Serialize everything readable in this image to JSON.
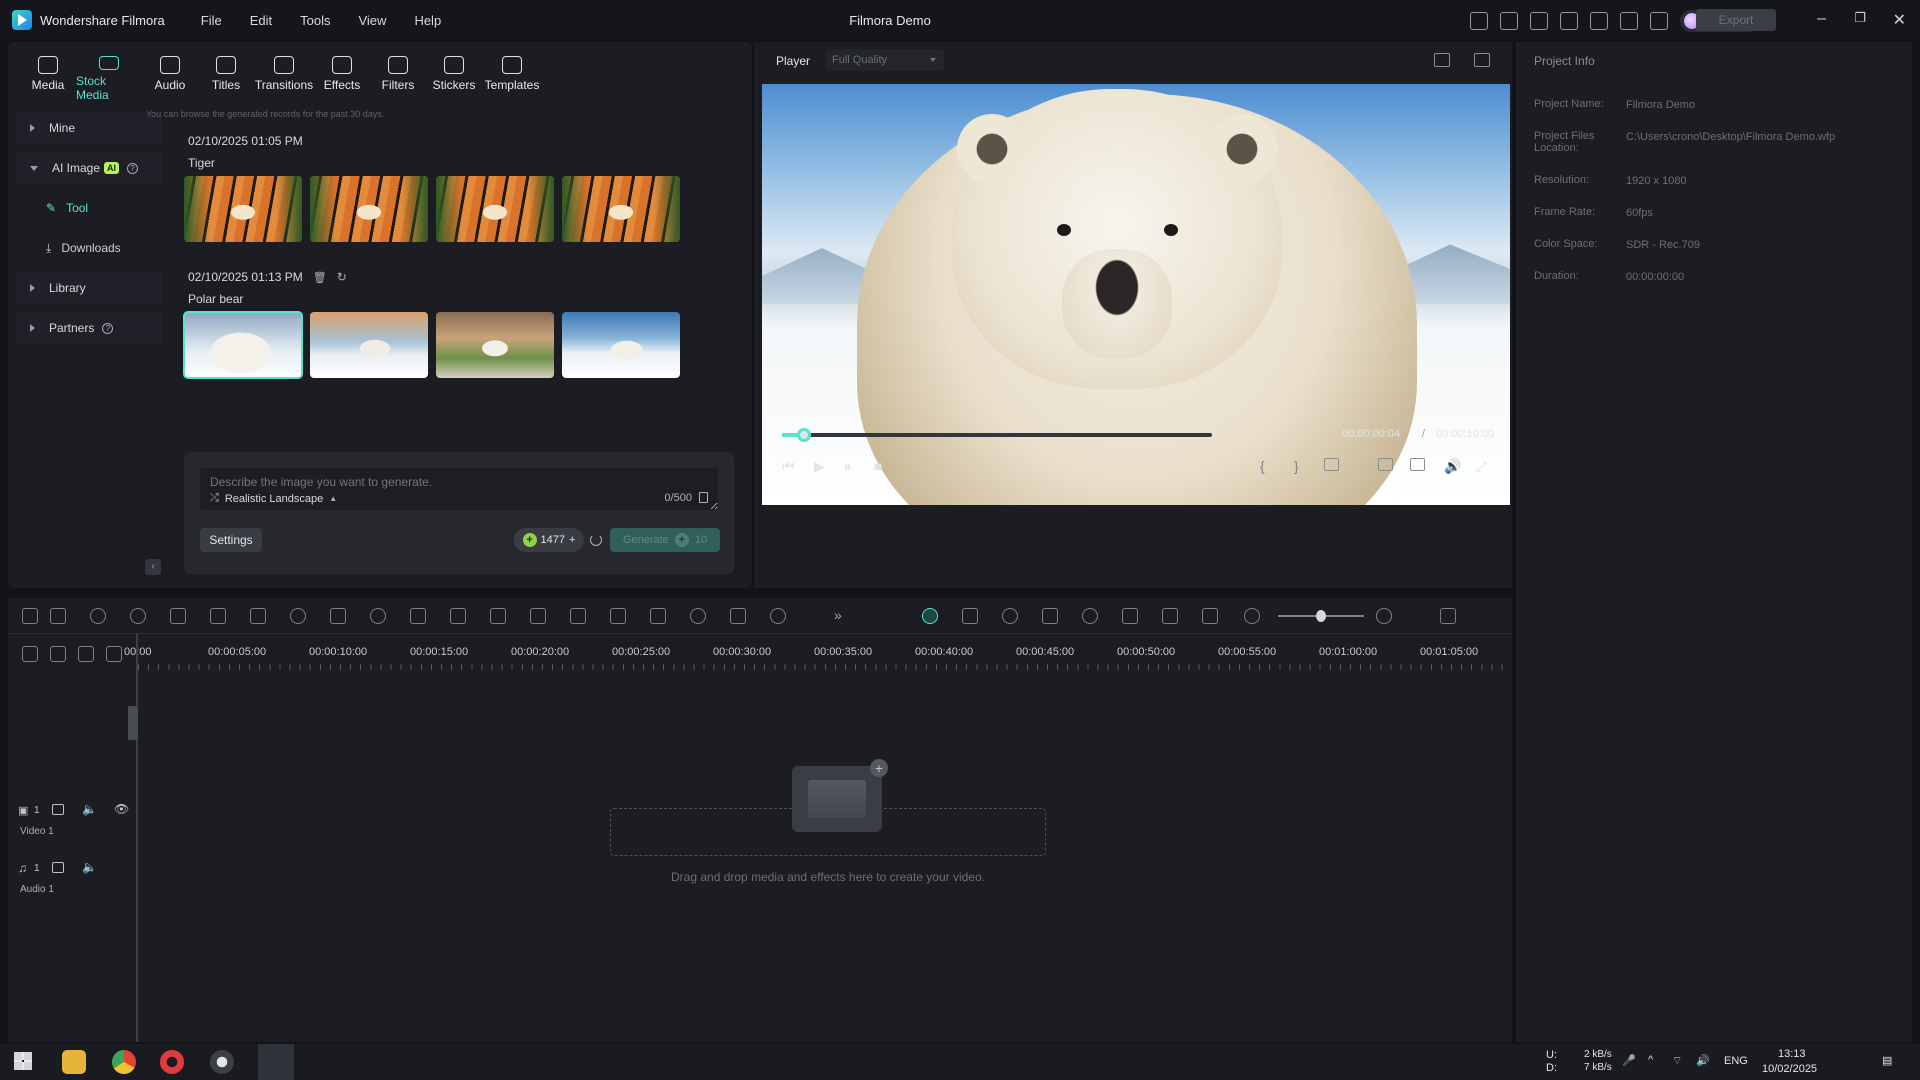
{
  "app": {
    "name": "Wondershare Filmora",
    "window_title": "Filmora Demo",
    "menu": [
      "File",
      "Edit",
      "Tools",
      "View",
      "Help"
    ],
    "credits": "1477",
    "export_label": "Export"
  },
  "tabs": [
    {
      "label": "Media",
      "icon": "media-icon",
      "active": false
    },
    {
      "label": "Stock Media",
      "icon": "stock-media-icon",
      "active": true
    },
    {
      "label": "Audio",
      "icon": "audio-icon",
      "active": false
    },
    {
      "label": "Titles",
      "icon": "titles-icon",
      "active": false
    },
    {
      "label": "Transitions",
      "icon": "transitions-icon",
      "active": false
    },
    {
      "label": "Effects",
      "icon": "effects-icon",
      "active": false
    },
    {
      "label": "Filters",
      "icon": "filters-icon",
      "active": false
    },
    {
      "label": "Stickers",
      "icon": "stickers-icon",
      "active": false
    },
    {
      "label": "Templates",
      "icon": "templates-icon",
      "active": false
    }
  ],
  "sidebar": {
    "mine": "Mine",
    "ai_image": "AI Image",
    "ai_badge": "AI",
    "tool": "Tool",
    "downloads": "Downloads",
    "library": "Library",
    "partners": "Partners"
  },
  "records_note": "You can browse the generated records for the past 30 days.",
  "groups": [
    {
      "date": "02/10/2025 01:05 PM",
      "label": "Tiger"
    },
    {
      "date": "02/10/2025 01:13 PM",
      "label": "Polar bear"
    }
  ],
  "generator": {
    "placeholder": "Describe the image you want to generate.",
    "style": "Realistic Landscape",
    "counter": "0/500",
    "settings_label": "Settings",
    "cost": "1477",
    "generate_label": "Generate",
    "generate_cost": "10"
  },
  "player": {
    "label": "Player",
    "quality": "Full Quality",
    "current_time": "00:00:00:04",
    "separator": "/",
    "total_time": "00:00:10:00",
    "progress": 0.05
  },
  "project_info": {
    "title": "Project Info",
    "rows": [
      {
        "k": "Project Name:",
        "v": "Filmora Demo"
      },
      {
        "k": "Project Files Location:",
        "v": "C:\\Users\\crono\\Desktop\\Filmora Demo.wfp"
      },
      {
        "k": "Resolution:",
        "v": "1920 x 1080"
      },
      {
        "k": "Frame Rate:",
        "v": "60fps"
      },
      {
        "k": "Color Space:",
        "v": "SDR - Rec.709"
      },
      {
        "k": "Duration:",
        "v": "00:00:00:00"
      }
    ]
  },
  "timeline": {
    "ticks": [
      "00:00",
      "00:00:05:00",
      "00:00:10:00",
      "00:00:15:00",
      "00:00:20:00",
      "00:00:25:00",
      "00:00:30:00",
      "00:00:35:00",
      "00:00:40:00",
      "00:00:45:00",
      "00:00:50:00",
      "00:00:55:00",
      "00:01:00:00",
      "00:01:05:00"
    ],
    "video_track": "Video 1",
    "audio_track": "Audio 1",
    "video_num": "1",
    "audio_num": "1",
    "drop_text": "Drag and drop media and effects here to create your video."
  },
  "taskbar": {
    "net_up_label": "U:",
    "net_down_label": "D:",
    "net_up": "2 kB/s",
    "net_down": "7 kB/s",
    "lang": "ENG",
    "time": "13:13",
    "date": "10/02/2025"
  }
}
